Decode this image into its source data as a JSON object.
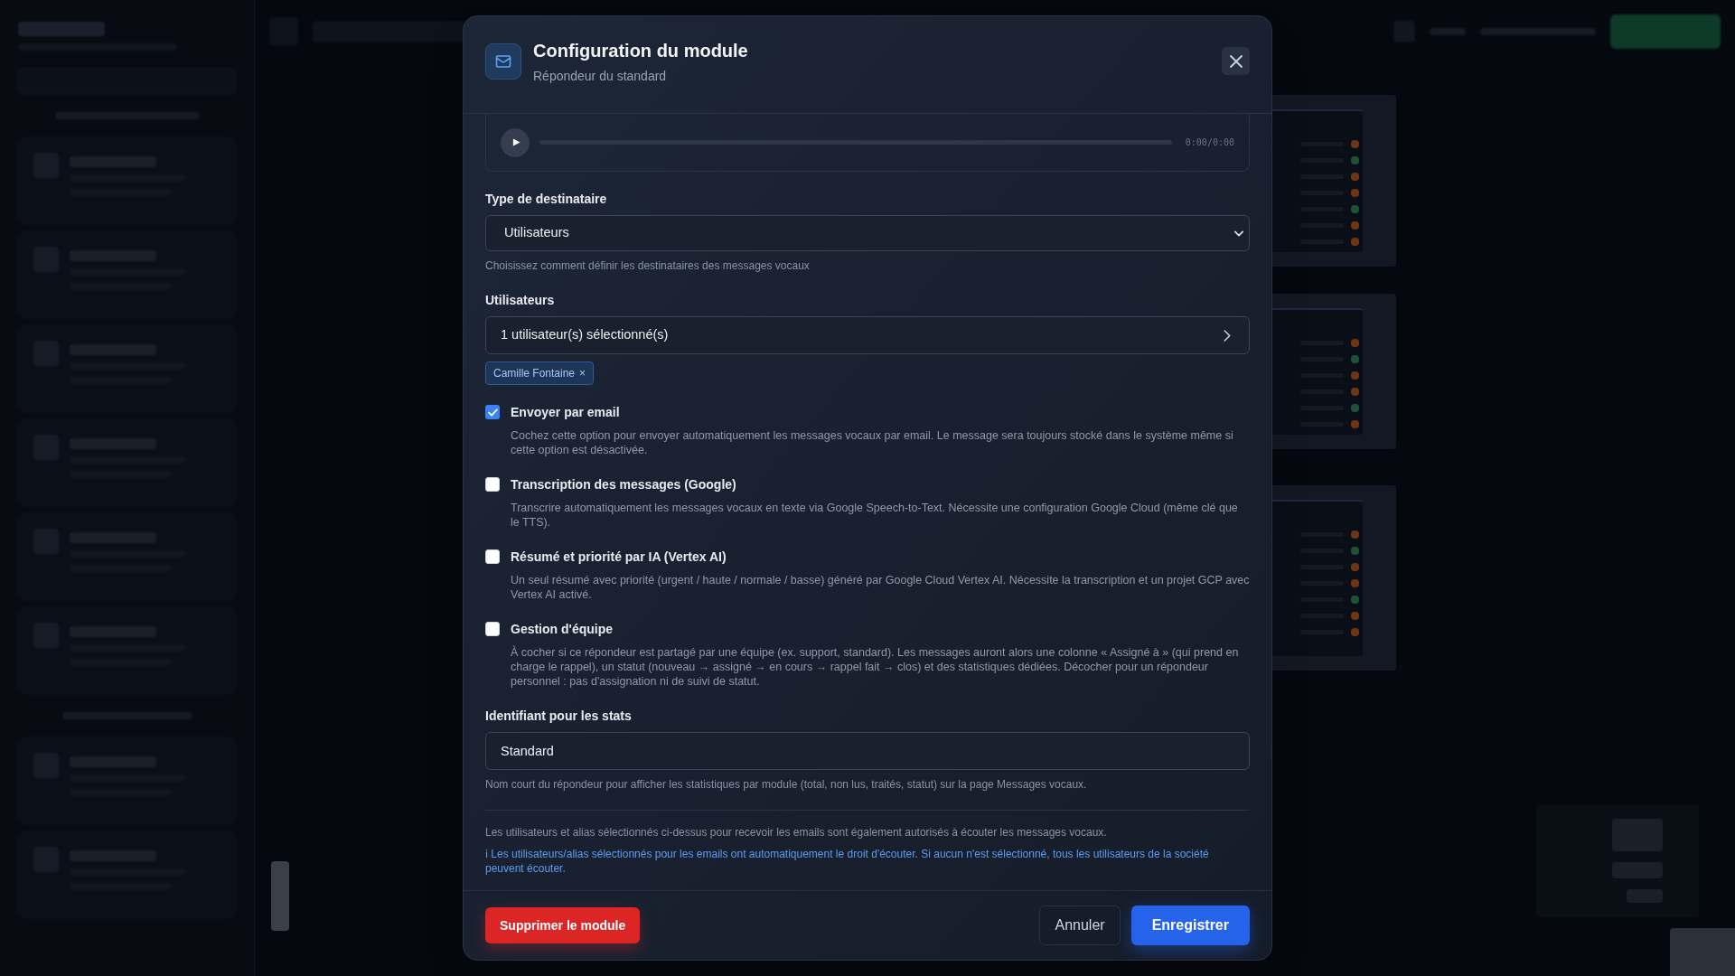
{
  "dialog": {
    "title": "Configuration du module",
    "subtitle": "Répondeur du standard"
  },
  "audio_player": {
    "time": "0:00/0:00"
  },
  "recipient_type": {
    "label": "Type de destinataire",
    "value": "Utilisateurs",
    "help": "Choisissez comment définir les destinataires des messages vocaux"
  },
  "users": {
    "label": "Utilisateurs",
    "value": "1 utilisateur(s) sélectionné(s)",
    "tags": [
      {
        "name": "Camille Fontaine",
        "remove": "×"
      }
    ]
  },
  "options": [
    {
      "label": "Envoyer par email",
      "description": "Cochez cette option pour envoyer automatiquement les messages vocaux par email. Le message sera toujours stocké dans le système même si cette option est désactivée.",
      "checked": true
    },
    {
      "label": "Transcription des messages (Google)",
      "description": "Transcrire automatiquement les messages vocaux en texte via Google Speech-to-Text. Nécessite une configuration Google Cloud (même clé que le TTS).",
      "checked": false
    },
    {
      "label": "Résumé et priorité par IA (Vertex AI)",
      "description": "Un seul résumé avec priorité (urgent / haute / normale / basse) généré par Google Cloud Vertex AI. Nécessite la transcription et un projet GCP avec Vertex AI activé.",
      "checked": false
    },
    {
      "label": "Gestion d'équipe",
      "description": "À cocher si ce répondeur est partagé par une équipe (ex. support, standard). Les messages auront alors une colonne « Assigné à » (qui prend en charge le rappel), un statut (nouveau → assigné → en cours → rappel fait → clos) et des statistiques dédiées. Décocher pour un répondeur personnel : pas d'assignation ni de suivi de statut.",
      "checked": false
    }
  ],
  "stats_id": {
    "label": "Identifiant pour les stats",
    "value": "Standard",
    "help": "Nom court du répondeur pour afficher les statistiques par module (total, non lus, traités, statut) sur la page Messages vocaux."
  },
  "access_note": "Les utilisateurs et alias sélectionnés ci-dessus pour recevoir les emails sont également autorisés à écouter les messages vocaux.",
  "info_note": "ℹ Les utilisateurs/alias sélectionnés pour les emails ont automatiquement le droit d'écouter. Si aucun n'est sélectionné, tous les utilisateurs de la société peuvent écouter.",
  "footer": {
    "delete": "Supprimer le module",
    "cancel": "Annuler",
    "save": "Enregistrer"
  }
}
